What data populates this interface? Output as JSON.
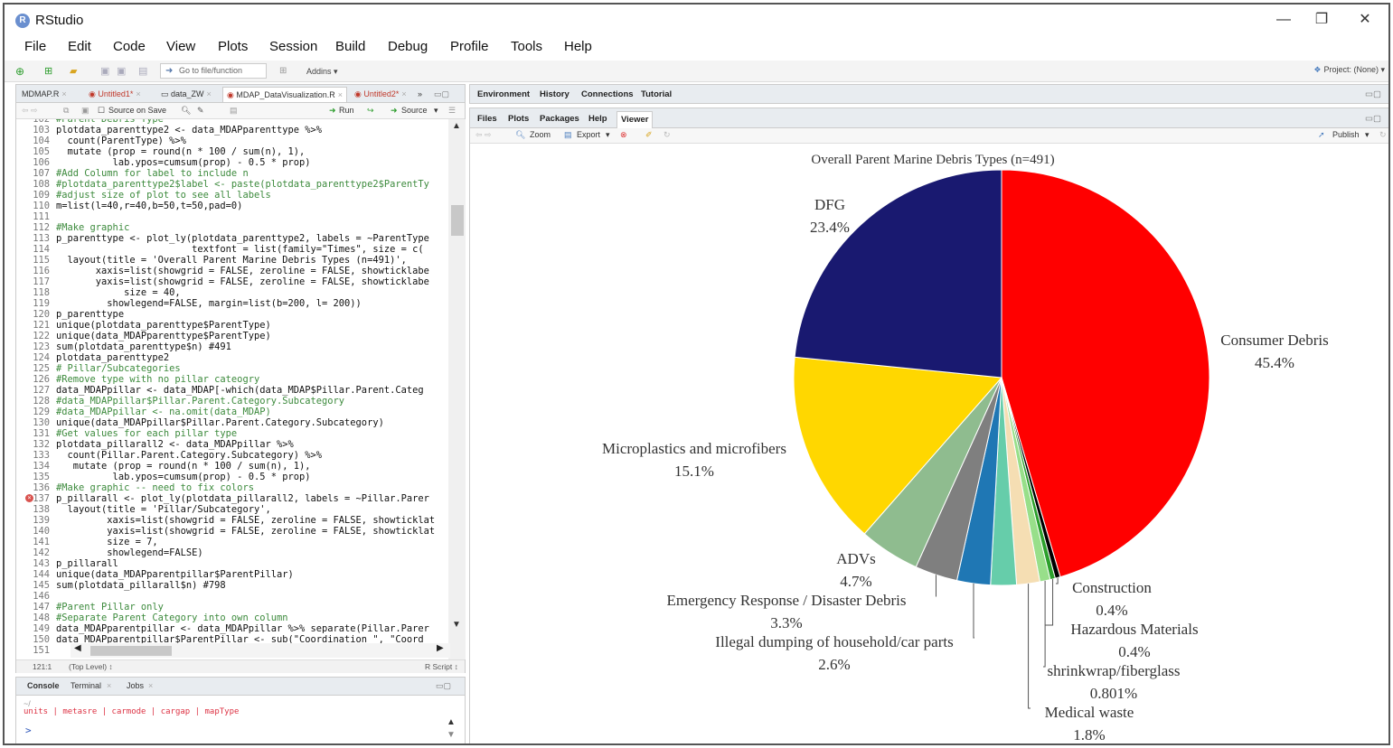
{
  "app": {
    "title": "RStudio",
    "icon": "R",
    "controls": [
      "—",
      "❐",
      "✕"
    ]
  },
  "menu": [
    "File",
    "Edit",
    "Code",
    "View",
    "Plots",
    "Session",
    "Build",
    "Debug",
    "Profile",
    "Tools",
    "Help"
  ],
  "toolbar": {
    "goto_placeholder": "Go to file/function",
    "addins": "Addins",
    "project": "Project: (None)"
  },
  "editor": {
    "tabs": [
      {
        "label": "MDMAP.R",
        "modified": false
      },
      {
        "label": "Untitled1*",
        "modified": true
      },
      {
        "label": "data_ZW",
        "modified": false
      },
      {
        "label": "MDAP_DataVisualization.R",
        "modified": false,
        "active": true
      },
      {
        "label": "Untitled2*",
        "modified": true
      }
    ],
    "more_tabs": "»",
    "source_on_save": "Source on Save",
    "run": "Run",
    "source": "Source",
    "cursor_pos": "121:1",
    "scope": "(Top Level) ↕",
    "file_type": "R Script ↕",
    "error_line": 137,
    "lines": [
      {
        "n": "102",
        "t": "#Parent Debris Type",
        "c": "cm"
      },
      {
        "n": "103",
        "t": "plotdata_parenttype2 <- data_MDAPparenttype %>%",
        "c": "ct"
      },
      {
        "n": "104",
        "t": "  count(ParentType) %>%",
        "c": "ct"
      },
      {
        "n": "105",
        "t": "  mutate (prop = round(n * 100 / sum(n), 1),",
        "c": "ct"
      },
      {
        "n": "106",
        "t": "          lab.ypos=cumsum(prop) - 0.5 * prop)",
        "c": "ct"
      },
      {
        "n": "107",
        "t": "#Add Column for label to include n",
        "c": "cm"
      },
      {
        "n": "108",
        "t": "#plotdata_parenttype2$label <- paste(plotdata_parenttype2$ParentTy",
        "c": "cm"
      },
      {
        "n": "109",
        "t": "#adjust size of plot to see all labels",
        "c": "cm"
      },
      {
        "n": "110",
        "t": "m=list(l=40,r=40,b=50,t=50,pad=0)",
        "c": "ct"
      },
      {
        "n": "111",
        "t": "",
        "c": "ct"
      },
      {
        "n": "112",
        "t": "#Make graphic",
        "c": "cm"
      },
      {
        "n": "113",
        "t": "p_parenttype <- plot_ly(plotdata_parenttype2, labels = ~ParentType",
        "c": "ct"
      },
      {
        "n": "114",
        "t": "                        textfont = list(family=\"Times\", size = c(",
        "c": "ct"
      },
      {
        "n": "115",
        "t": "  layout(title = 'Overall Parent Marine Debris Types (n=491)',",
        "c": "ct"
      },
      {
        "n": "116",
        "t": "       xaxis=list(showgrid = FALSE, zeroline = FALSE, showticklabe",
        "c": "ct"
      },
      {
        "n": "117",
        "t": "       yaxis=list(showgrid = FALSE, zeroline = FALSE, showticklabe",
        "c": "ct"
      },
      {
        "n": "118",
        "t": "            size = 40,",
        "c": "ct"
      },
      {
        "n": "119",
        "t": "         showlegend=FALSE, margin=list(b=200, l= 200))",
        "c": "ct"
      },
      {
        "n": "120",
        "t": "p_parenttype",
        "c": "ct"
      },
      {
        "n": "121",
        "t": "unique(plotdata_parenttype$ParentType)",
        "c": "ct"
      },
      {
        "n": "122",
        "t": "unique(data_MDAPparenttype$ParentType)",
        "c": "ct"
      },
      {
        "n": "123",
        "t": "sum(plotdata_parenttype$n) #491",
        "c": "ct"
      },
      {
        "n": "124",
        "t": "plotdata_parenttype2",
        "c": "ct"
      },
      {
        "n": "125",
        "t": "# Pillar/Subcategories",
        "c": "cm"
      },
      {
        "n": "126",
        "t": "#Remove type with no pillar cateogry",
        "c": "cm"
      },
      {
        "n": "127",
        "t": "data_MDAPpillar <- data_MDAP[-which(data_MDAP$Pillar.Parent.Categ",
        "c": "ct"
      },
      {
        "n": "128",
        "t": "#data_MDAPpillar$Pillar.Parent.Category.Subcategory",
        "c": "cm"
      },
      {
        "n": "129",
        "t": "#data_MDAPpillar <- na.omit(data_MDAP)",
        "c": "cm"
      },
      {
        "n": "130",
        "t": "unique(data_MDAPpillar$Pillar.Parent.Category.Subcategory)",
        "c": "ct"
      },
      {
        "n": "131",
        "t": "#Get values for each pillar type",
        "c": "cm"
      },
      {
        "n": "132",
        "t": "plotdata_pillarall2 <- data_MDAPpillar %>%",
        "c": "ct"
      },
      {
        "n": "133",
        "t": "  count(Pillar.Parent.Category.Subcategory) %>%",
        "c": "ct"
      },
      {
        "n": "134",
        "t": "   mutate (prop = round(n * 100 / sum(n), 1),",
        "c": "ct"
      },
      {
        "n": "135",
        "t": "          lab.ypos=cumsum(prop) - 0.5 * prop)",
        "c": "ct"
      },
      {
        "n": "136",
        "t": "#Make graphic -- need to fix colors",
        "c": "cm"
      },
      {
        "n": "137",
        "t": "p_pillarall <- plot_ly(plotdata_pillarall2, labels = ~Pillar.Parer",
        "c": "ct"
      },
      {
        "n": "138",
        "t": "  layout(title = 'Pillar/Subcategory',",
        "c": "ct"
      },
      {
        "n": "139",
        "t": "         xaxis=list(showgrid = FALSE, zeroline = FALSE, showticklat",
        "c": "ct"
      },
      {
        "n": "140",
        "t": "         yaxis=list(showgrid = FALSE, zeroline = FALSE, showticklat",
        "c": "ct"
      },
      {
        "n": "141",
        "t": "         size = 7,",
        "c": "ct"
      },
      {
        "n": "142",
        "t": "         showlegend=FALSE)",
        "c": "ct"
      },
      {
        "n": "143",
        "t": "p_pillarall",
        "c": "ct"
      },
      {
        "n": "144",
        "t": "unique(data_MDAPparentpillar$ParentPillar)",
        "c": "ct"
      },
      {
        "n": "145",
        "t": "sum(plotdata_pillarall$n) #798",
        "c": "ct"
      },
      {
        "n": "146",
        "t": "",
        "c": "ct"
      },
      {
        "n": "147",
        "t": "#Parent Pillar only",
        "c": "cm"
      },
      {
        "n": "148",
        "t": "#Separate Parent Category into own column",
        "c": "cm"
      },
      {
        "n": "149",
        "t": "data_MDAPparentpillar <- data_MDAPpillar %>% separate(Pillar.Parer",
        "c": "ct"
      },
      {
        "n": "150",
        "t": "data_MDAPparentpillar$ParentPillar <- sub(\"Coordination \", \"Coord",
        "c": "ct"
      },
      {
        "n": "151",
        "t": "",
        "c": "ct"
      }
    ]
  },
  "console": {
    "tabs": [
      "Console",
      "Terminal",
      "Jobs"
    ],
    "path": "~/",
    "echo": "units | metasre | carmode | cargap | mapType",
    "prompt": ">"
  },
  "env_tabs": [
    "Environment",
    "History",
    "Connections",
    "Tutorial"
  ],
  "viewer": {
    "tabs": [
      "Files",
      "Plots",
      "Packages",
      "Help",
      "Viewer"
    ],
    "active_tab": "Viewer",
    "zoom": "Zoom",
    "export": "Export",
    "publish": "Publish"
  },
  "chart_data": {
    "type": "pie",
    "title": "Overall Parent Marine Debris Types (n=491)",
    "slices": [
      {
        "label": "Consumer Debris",
        "pct_text": "45.4%",
        "value": 45.4,
        "color": "#ff0000"
      },
      {
        "label": "Construction",
        "pct_text": "0.4%",
        "value": 0.4,
        "color": "#000000"
      },
      {
        "label": "Hazardous Materials",
        "pct_text": "0.4%",
        "value": 0.4,
        "color": "#2ca02c"
      },
      {
        "label": "shrinkwrap/fiberglass",
        "pct_text": "0.801%",
        "value": 0.801,
        "color": "#98df8a"
      },
      {
        "label": "Medical waste",
        "pct_text": "1.8%",
        "value": 1.8,
        "color": "#f5deb3"
      },
      {
        "label": "",
        "pct_text": "",
        "value": 2.0,
        "color": "#66cdaa"
      },
      {
        "label": "Illegal dumping of household/car parts",
        "pct_text": "2.6%",
        "value": 2.6,
        "color": "#1f77b4"
      },
      {
        "label": "Emergency Response / Disaster Debris",
        "pct_text": "3.3%",
        "value": 3.3,
        "color": "#7f7f7f"
      },
      {
        "label": "ADVs",
        "pct_text": "4.7%",
        "value": 4.7,
        "color": "#8fbc8f"
      },
      {
        "label": "Microplastics and microfibers",
        "pct_text": "15.1%",
        "value": 15.1,
        "color": "#ffd700"
      },
      {
        "label": "DFG",
        "pct_text": "23.4%",
        "value": 23.4,
        "color": "#191970"
      }
    ]
  }
}
